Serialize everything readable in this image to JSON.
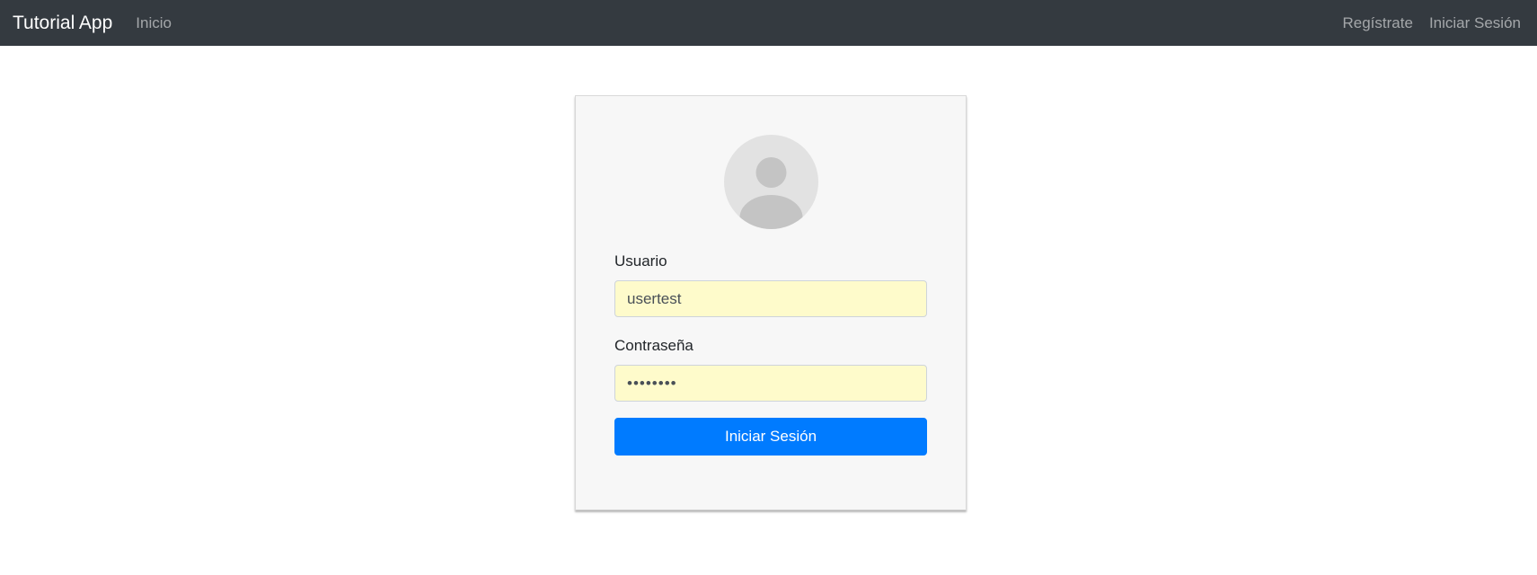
{
  "navbar": {
    "brand": "Tutorial App",
    "left_links": [
      {
        "label": "Inicio"
      }
    ],
    "right_links": [
      {
        "label": "Regístrate"
      },
      {
        "label": "Iniciar Sesión"
      }
    ]
  },
  "login": {
    "avatar_icon": "user-avatar-icon",
    "username_label": "Usuario",
    "username_value": "usertest",
    "password_label": "Contraseña",
    "password_value": "password",
    "submit_label": "Iniciar Sesión"
  },
  "colors": {
    "navbar_bg": "#343a40",
    "primary": "#007bff",
    "autofill_bg": "#fefbcb",
    "card_bg": "#f7f7f7"
  }
}
